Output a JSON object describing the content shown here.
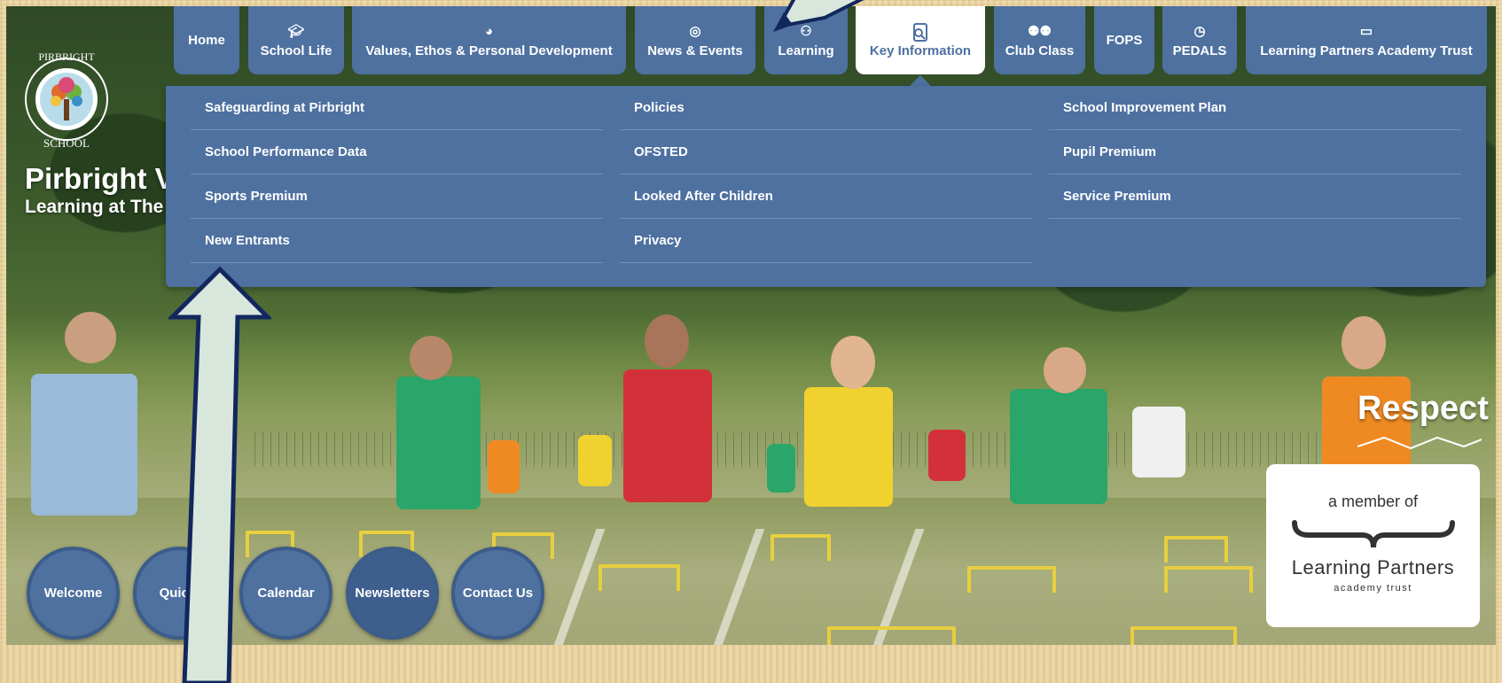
{
  "nav": {
    "items": [
      {
        "label": "Home",
        "icon": ""
      },
      {
        "label": "School Life",
        "icon": "graduation-cap-icon"
      },
      {
        "label": "Values, Ethos & Personal Development",
        "icon": "globe-icon"
      },
      {
        "label": "News & Events",
        "icon": "instagram-icon"
      },
      {
        "label": "Learning",
        "icon": "reading-icon"
      },
      {
        "label": "Key Information",
        "icon": "document-search-icon"
      },
      {
        "label": "Club Class",
        "icon": "group-icon"
      },
      {
        "label": "FOPS",
        "icon": ""
      },
      {
        "label": "PEDALS",
        "icon": "apple-icon"
      },
      {
        "label": "Learning Partners Academy Trust",
        "icon": "classroom-icon"
      }
    ],
    "active": "Key Information"
  },
  "dropdown": {
    "col1": [
      "Safeguarding at Pirbright",
      "School Performance Data",
      "Sports Premium",
      "New Entrants"
    ],
    "col2": [
      "Policies",
      "OFSTED",
      "Looked After Children",
      "Privacy"
    ],
    "col3": [
      "School Improvement Plan",
      "Pupil Premium",
      "Service Premium"
    ]
  },
  "header": {
    "logo_text_top": "PIRBRIGHT",
    "logo_text_bottom": "SCHOOL",
    "title": "Pirbright V",
    "subtitle": "Learning at The"
  },
  "hero": {
    "value_word": "Respect"
  },
  "member_card": {
    "line1": "a member of",
    "line2": "Learning Partners",
    "line3": "academy trust"
  },
  "quick_links": [
    "Welcome",
    "Quickl",
    "Calendar",
    "Newsletters",
    "Contact Us"
  ],
  "colors": {
    "nav_blue": "#4e71a0",
    "active_bg": "#ffffff",
    "arrow_fill": "#d9e6dc",
    "arrow_stroke": "#12275e",
    "parchment": "#e9d3a2"
  }
}
